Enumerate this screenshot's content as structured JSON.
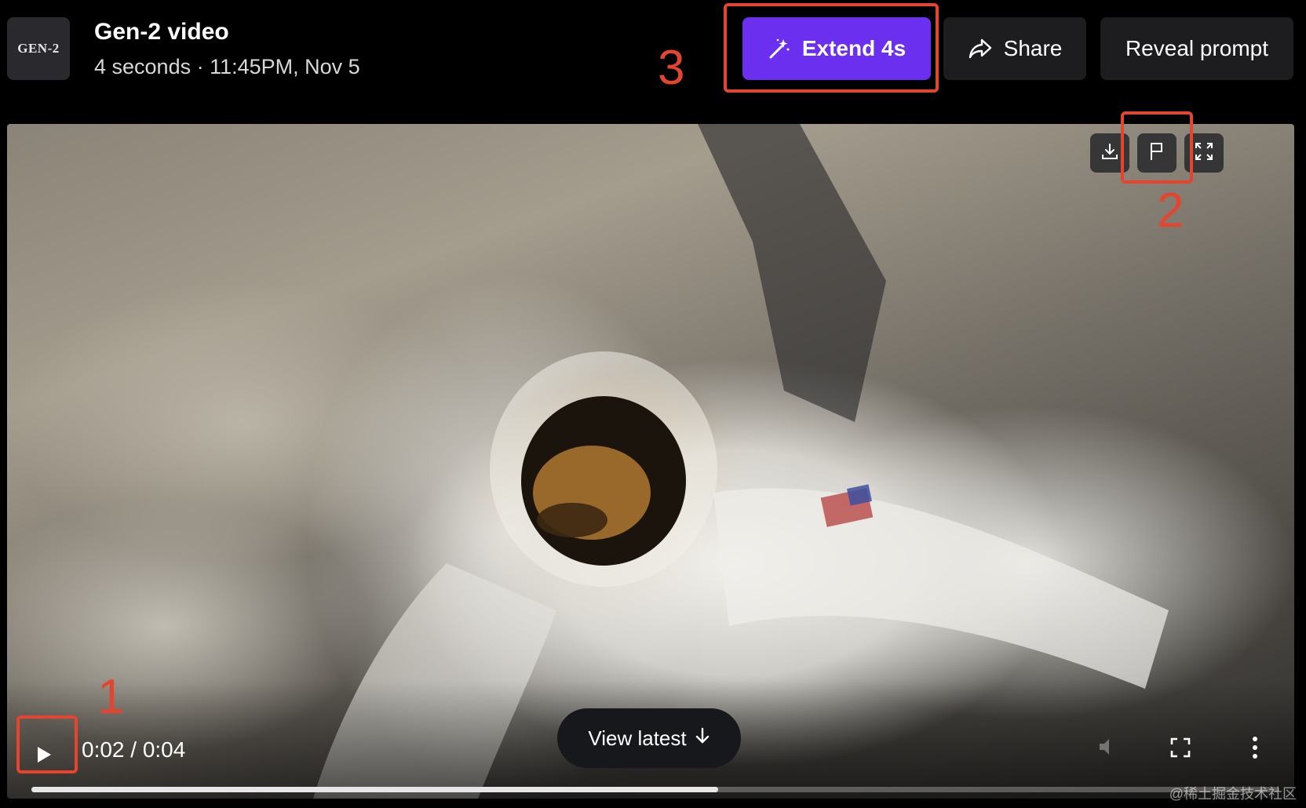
{
  "header": {
    "thumbnail_label": "GEN-2",
    "title": "Gen-2 video",
    "meta": "4 seconds · 11:45PM, Nov 5",
    "buttons": {
      "extend_label": "Extend 4s",
      "share_label": "Share",
      "reveal_label": "Reveal prompt"
    }
  },
  "video": {
    "current_time": "0:02",
    "duration": "0:04",
    "time_display": "0:02 / 0:04",
    "progress_fraction": 0.55,
    "view_latest_label": "View latest",
    "tools": [
      "download-icon",
      "flag-icon",
      "expand-icon"
    ],
    "controls": [
      "play-icon",
      "volume-icon",
      "fullscreen-icon",
      "more-options-icon"
    ]
  },
  "annotations": [
    "1",
    "2",
    "3"
  ],
  "colors": {
    "accent": "#6b2ff0",
    "annotation": "#e5452e",
    "button_bg": "#1d1d20"
  },
  "watermark": "@稀土掘金技术社区"
}
